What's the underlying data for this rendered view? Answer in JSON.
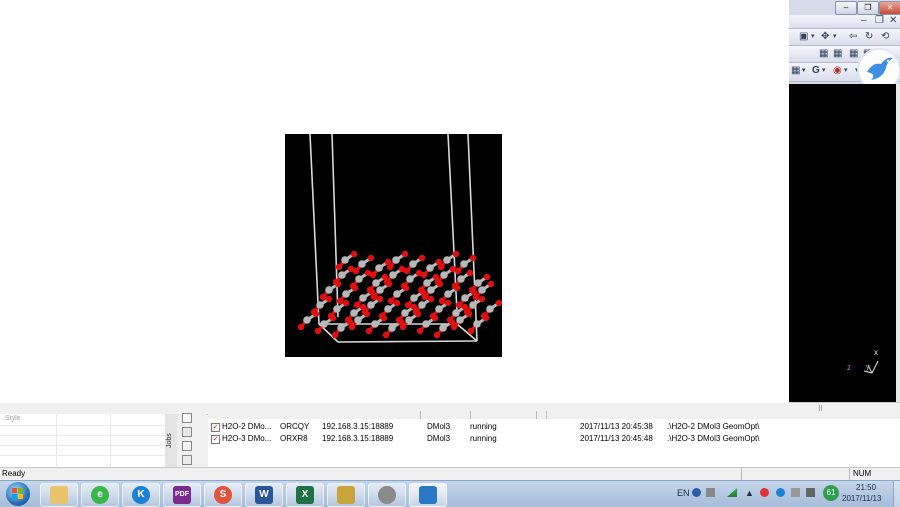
{
  "right_panel": {
    "window_buttons": [
      "–",
      "❐",
      "✕"
    ],
    "sub_window_buttons": [
      "–",
      "❐",
      "✕"
    ],
    "toolbar_row1": [
      "▣",
      "▾",
      "✥",
      "▾",
      "⇦",
      "↻",
      "⟲"
    ],
    "toolbar_row2": [
      "▦",
      "▦",
      "▦",
      "▦"
    ],
    "toolbar_row3": [
      "▦",
      "▾",
      "G",
      "▾",
      "◉",
      "▾",
      "▾"
    ],
    "axis_labels": {
      "z": "z",
      "x": "x",
      "y": "y"
    },
    "colors": {
      "viewport": "#000000",
      "panel": "#d6dbe9"
    }
  },
  "crystal_view": {
    "colors": {
      "oxygen": "#e01010",
      "silicon": "#b8b8b8",
      "cell": "#d8d8d8",
      "background": "#000000"
    }
  },
  "style_pane": {
    "label": "Style"
  },
  "jobs_strip": {
    "label": "Jobs"
  },
  "jobs": [
    {
      "name": "H2O-2 DMo...",
      "id": "ORCQY",
      "server": "192.168.3.15:18889",
      "module": "DMol3",
      "status": "running",
      "started": "2017/11/13 20:45:38",
      "path": ".\\H2O-2 DMol3 GeomOpt\\"
    },
    {
      "name": "H2O-3 DMo...",
      "id": "ORXR8",
      "server": "192.168.3.15:18889",
      "module": "DMol3",
      "status": "running",
      "started": "2017/11/13 20:45:48",
      "path": ".\\H2O-3 DMol3 GeomOpt\\"
    }
  ],
  "status_bar": {
    "text": "Ready",
    "num": "NUM"
  },
  "taskbar": {
    "apps": [
      "folder",
      "360-browser",
      "k-app",
      "PDF",
      "s-app",
      "W",
      "X",
      "installer",
      "materials-studio",
      "app-window"
    ],
    "tray": {
      "lang": "EN",
      "battery": "61",
      "time": "21:50",
      "date": "2017/11/13"
    }
  }
}
